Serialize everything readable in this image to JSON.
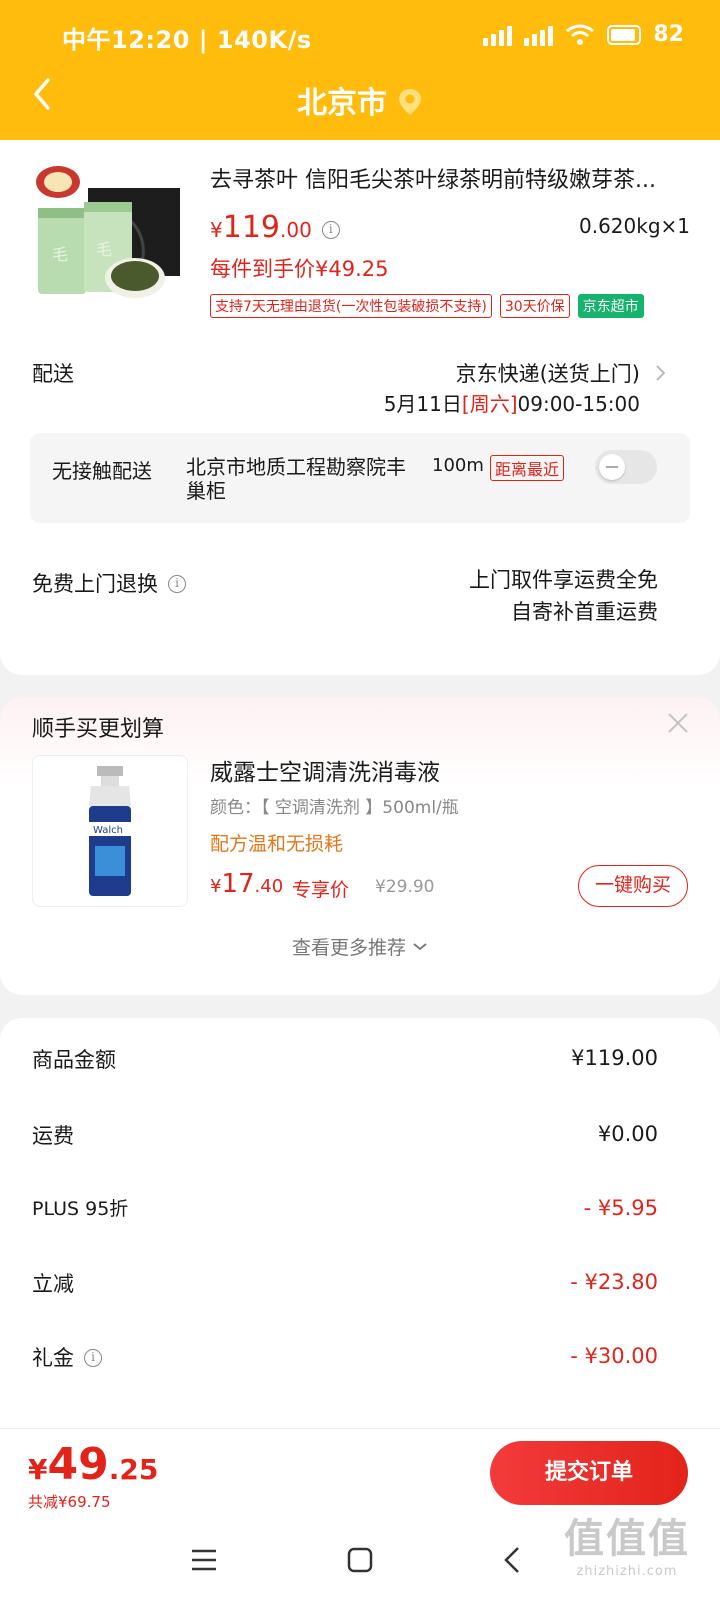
{
  "status_bar": {
    "time": "中午12:20 | 140K/s",
    "battery": "82"
  },
  "header": {
    "title": "北京市"
  },
  "product": {
    "title": "去寻茶叶 信阳毛尖茶叶绿茶明前特级嫩芽茶...",
    "price_symbol": "¥",
    "price_int": "119",
    "price_dec": ".00",
    "weight_qty": "0.620kg×1",
    "final_price": "每件到手价¥49.25",
    "tags": [
      "支持7天无理由退货(一次性包装破损不支持)",
      "30天价保",
      "京东超市"
    ]
  },
  "delivery": {
    "label": "配送",
    "method": "京东快递(送货上门)",
    "date": "5月11日",
    "weekday": "[周六]",
    "time": "09:00-15:00"
  },
  "contactless": {
    "label": "无接触配送",
    "place": "北京市地质工程勘察院丰巢柜",
    "distance": "100m",
    "nearest": "距离最近"
  },
  "return_service": {
    "label": "免费上门退换",
    "line1": "上门取件享运费全免",
    "line2": "自寄补首重运费"
  },
  "recommend": {
    "title": "顺手买更划算",
    "name": "威露士空调清洗消毒液",
    "spec": "颜色：【 空调清洗剂 】500ml/瓶",
    "feature": "配方温和无损耗",
    "price_symbol": "¥",
    "price_int": "17",
    "price_dec": ".40",
    "exclusive": "专享价",
    "original": "¥29.90",
    "buy_label": "一键购买",
    "more_label": "查看更多推荐"
  },
  "amounts": [
    {
      "label": "商品金额",
      "value": "¥119.00",
      "red": false
    },
    {
      "label": "运费",
      "value": "¥0.00",
      "red": false
    },
    {
      "label": "PLUS 95折",
      "value": "- ¥5.95",
      "red": true
    },
    {
      "label": "立减",
      "value": "- ¥23.80",
      "red": true
    },
    {
      "label": "礼金",
      "value": "- ¥30.00",
      "red": true
    }
  ],
  "footer": {
    "total_symbol": "¥",
    "total_int": "49",
    "total_dec": ".25",
    "saved": "共减¥69.75",
    "submit_label": "提交订单"
  },
  "watermark": {
    "main": "值值值",
    "sub": "zhizhizhi.com"
  },
  "colors": {
    "header": "#ffbc0d",
    "accent_red": "#e2231a",
    "orange": "#e5771a",
    "green_tag": "#15b36b"
  }
}
